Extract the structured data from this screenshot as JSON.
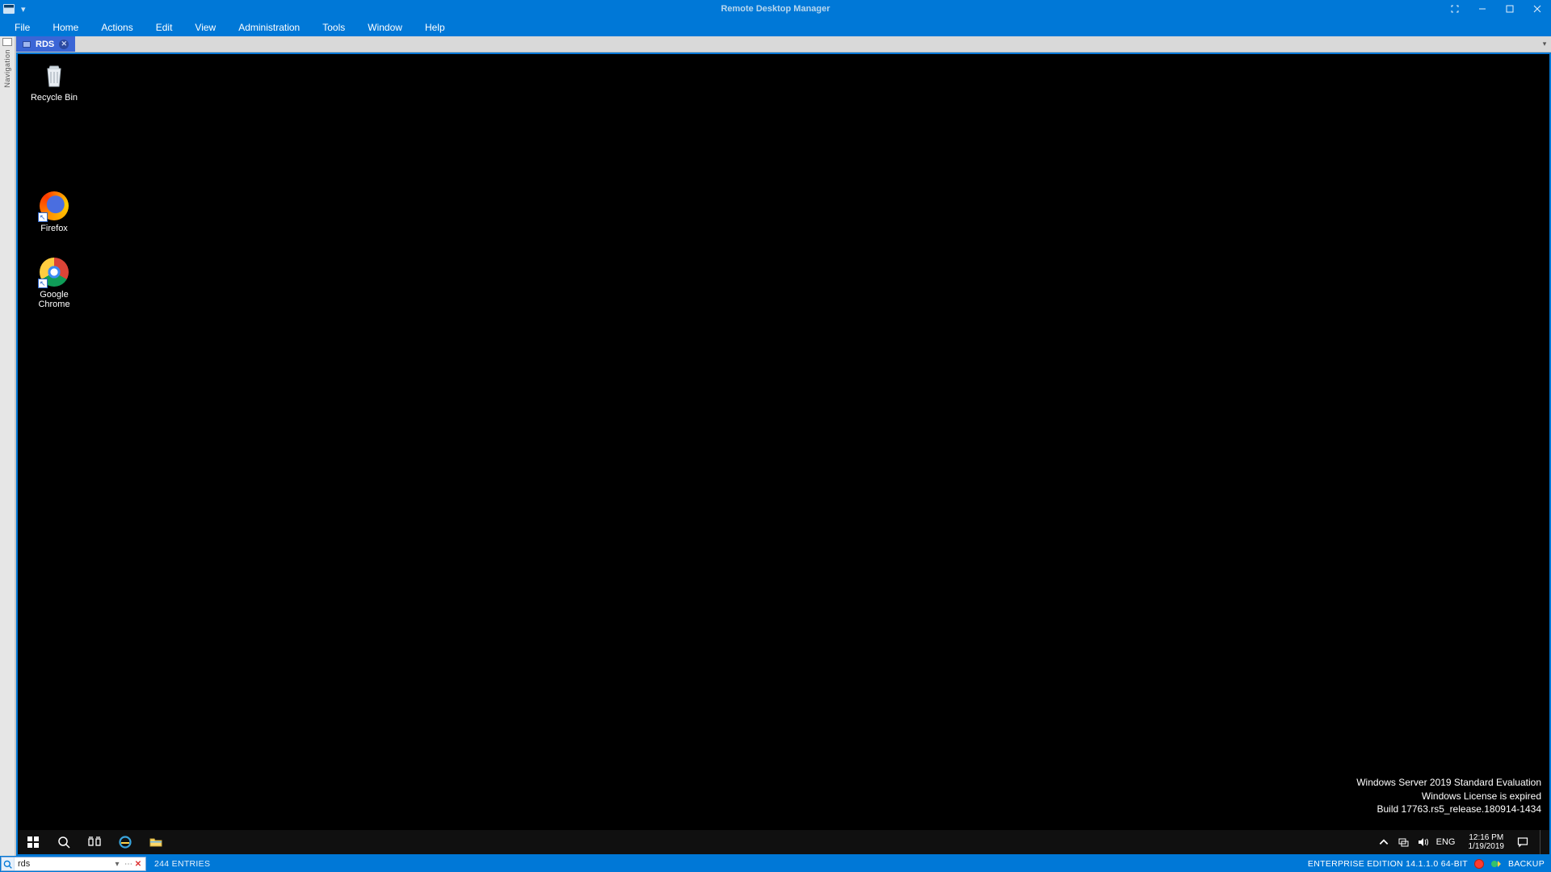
{
  "titlebar": {
    "dropdown_glyph": "▾",
    "title": "Remote Desktop Manager"
  },
  "menus": [
    "File",
    "Home",
    "Actions",
    "Edit",
    "View",
    "Administration",
    "Tools",
    "Window",
    "Help"
  ],
  "nav_rail_label": "Navigation",
  "tab": {
    "label": "RDS"
  },
  "desktop_icons": [
    {
      "key": "recycle-bin",
      "label": "Recycle Bin",
      "shortcut": false
    },
    {
      "key": "firefox",
      "label": "Firefox",
      "shortcut": true
    },
    {
      "key": "chrome",
      "label": "Google\nChrome",
      "shortcut": true
    }
  ],
  "watermark": {
    "line1": "Windows Server 2019 Standard Evaluation",
    "line2": "Windows License is expired",
    "line3": "Build 17763.rs5_release.180914-1434"
  },
  "remote_taskbar": {
    "lang": "ENG",
    "time": "12:16 PM",
    "date": "1/19/2019"
  },
  "statusbar": {
    "search_value": "rds",
    "entries": "244 ENTRIES",
    "edition": "ENTERPRISE EDITION 14.1.1.0 64-BIT",
    "backup": "BACKUP"
  }
}
